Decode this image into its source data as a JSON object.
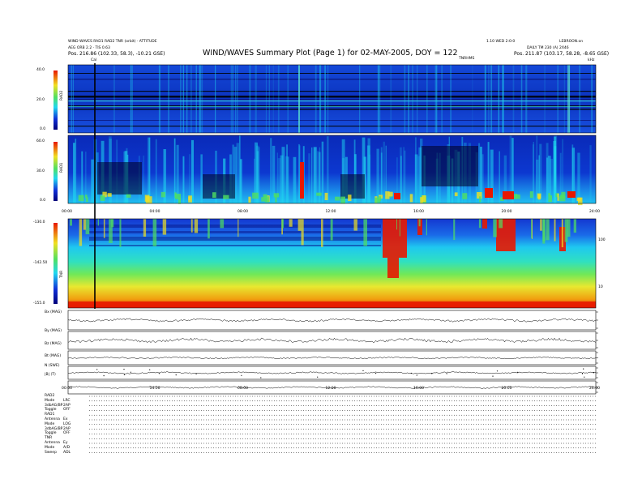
{
  "header": {
    "top_left_line1": "WIND WAVES RAD1 RAD2 TNR (orbit) · ATTITUDE",
    "top_left_line2": "AEG ORB 2.2 · TIS 0.63",
    "title": "WIND/WAVES Summary Plot (Page 1) for 02-MAY-2005, DOY = 122",
    "top_right_line1": "1.10 WED 2:0:0",
    "top_right_line2": "LEBROON.on",
    "top_right_line3": "DAILY TM 230 (A) 2X46",
    "position_left": "Pos.   216.86 (102.33, 58.3), -10.21 GSE)",
    "position_right": "Pos.   211.87 (103.17, 58.28, -8.65 GSE)",
    "marker_label": "Cal",
    "tnr_label_top": "TNRHMS",
    "tnr_label_right": "kHz"
  },
  "colors": {
    "deep": "#00007a",
    "blue": "#1030d8",
    "cyan": "#1fd8f0",
    "green": "#50e060",
    "yellow": "#f0e020",
    "red": "#e81800"
  },
  "chart_data": [
    {
      "type": "heatmap",
      "name": "RAD2",
      "ylabel": "RAD2",
      "yticks": [
        "40.0",
        "20.0",
        "0.0"
      ],
      "colorbar": "rainbow"
    },
    {
      "type": "heatmap",
      "name": "RAD1",
      "ylabel": "RAD1",
      "yticks": [
        "60.0",
        "30.0",
        "0.0"
      ],
      "xticks": [
        "00:00",
        "04:00",
        "08:00",
        "12:00",
        "16:00",
        "20:00",
        "24:00"
      ],
      "colorbar": "rainbow"
    },
    {
      "type": "heatmap",
      "name": "TNR",
      "ylabel": "TNR",
      "yticks": [
        "-130.0",
        "-142.50",
        "-155.0"
      ],
      "right_ticks": [
        "100",
        "10"
      ],
      "xticks": [
        "00:00",
        "04:00",
        "08:00",
        "12:00",
        "16:00",
        "20:00",
        "24:00"
      ],
      "colorbar": "rainbow"
    },
    {
      "type": "line",
      "name": "Bx (MAG)",
      "ylabel": "Bx (MAG)"
    },
    {
      "type": "line",
      "name": "By (MAG)",
      "ylabel": "By (MAG)"
    },
    {
      "type": "line",
      "name": "Bz (MAG)",
      "ylabel": "Bz (MAG)"
    },
    {
      "type": "line",
      "name": "Bt (MAG)",
      "ylabel": "Bt (MAG)"
    },
    {
      "type": "line",
      "name": "N (SWE)",
      "ylabel": "N (SWE)"
    },
    {
      "type": "line",
      "name": "|B| (T)",
      "ylabel": "|B| (T)",
      "xticks": [
        "00:00",
        "04:00",
        "08:00",
        "12:00",
        "16:00",
        "20:00",
        "24:00"
      ]
    }
  ],
  "footer": {
    "rows": [
      {
        "label": "RAD2",
        "value": ""
      },
      {
        "label": "Mode",
        "value": "LRC"
      },
      {
        "label": "3dbAG/BP",
        "value": "2AP"
      },
      {
        "label": "Toggle",
        "value": "OFF"
      },
      {
        "label": "RAD1",
        "value": ""
      },
      {
        "label": "Antenna",
        "value": "Ex"
      },
      {
        "label": "Mode",
        "value": "LOG"
      },
      {
        "label": "3dbAG/BP",
        "value": "2AP"
      },
      {
        "label": "Toggle",
        "value": "OFF"
      },
      {
        "label": "TNR",
        "value": ""
      },
      {
        "label": "Antenna",
        "value": "Ey"
      },
      {
        "label": "Mode",
        "value": "A/D"
      },
      {
        "label": "Sweep",
        "value": "ADL"
      }
    ]
  }
}
